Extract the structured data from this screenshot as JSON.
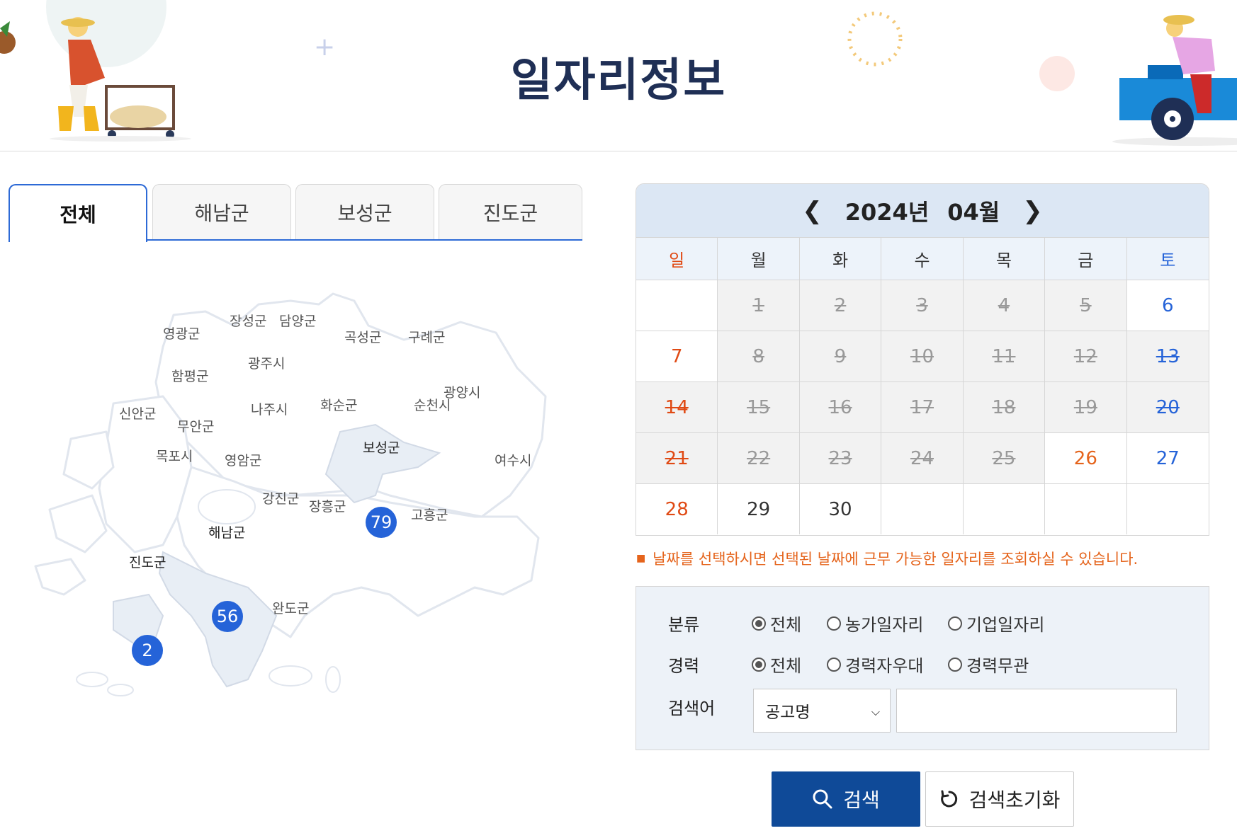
{
  "header": {
    "title": "일자리정보"
  },
  "tabs": [
    {
      "label": "전체",
      "active": true
    },
    {
      "label": "해남군",
      "active": false
    },
    {
      "label": "보성군",
      "active": false
    },
    {
      "label": "진도군",
      "active": false
    }
  ],
  "map": {
    "regions": [
      {
        "name": "영광군"
      },
      {
        "name": "장성군"
      },
      {
        "name": "담양군"
      },
      {
        "name": "곡성군"
      },
      {
        "name": "구례군"
      },
      {
        "name": "광주시"
      },
      {
        "name": "함평군"
      },
      {
        "name": "광양시"
      },
      {
        "name": "신안군"
      },
      {
        "name": "나주시"
      },
      {
        "name": "화순군"
      },
      {
        "name": "순천시"
      },
      {
        "name": "무안군"
      },
      {
        "name": "목포시"
      },
      {
        "name": "영암군"
      },
      {
        "name": "보성군"
      },
      {
        "name": "여수시"
      },
      {
        "name": "강진군"
      },
      {
        "name": "장흥군"
      },
      {
        "name": "고흥군"
      },
      {
        "name": "해남군"
      },
      {
        "name": "진도군"
      },
      {
        "name": "완도군"
      }
    ],
    "counts": {
      "boseong": "79",
      "haenam": "56",
      "jindo": "2"
    }
  },
  "calendar": {
    "year_label": "2024년",
    "month_label": "04월",
    "weekdays": [
      "일",
      "월",
      "화",
      "수",
      "목",
      "금",
      "토"
    ],
    "days": [
      {
        "label": "",
        "state": "blank"
      },
      {
        "label": "1",
        "state": "past"
      },
      {
        "label": "2",
        "state": "past"
      },
      {
        "label": "3",
        "state": "past"
      },
      {
        "label": "4",
        "state": "past"
      },
      {
        "label": "5",
        "state": "past"
      },
      {
        "label": "6",
        "state": "sat"
      },
      {
        "label": "7",
        "state": "sun"
      },
      {
        "label": "8",
        "state": "past"
      },
      {
        "label": "9",
        "state": "past"
      },
      {
        "label": "10",
        "state": "past"
      },
      {
        "label": "11",
        "state": "past"
      },
      {
        "label": "12",
        "state": "past"
      },
      {
        "label": "13",
        "state": "past-sat"
      },
      {
        "label": "14",
        "state": "past-sun"
      },
      {
        "label": "15",
        "state": "past"
      },
      {
        "label": "16",
        "state": "past"
      },
      {
        "label": "17",
        "state": "past"
      },
      {
        "label": "18",
        "state": "past"
      },
      {
        "label": "19",
        "state": "past"
      },
      {
        "label": "20",
        "state": "past-sat"
      },
      {
        "label": "21",
        "state": "past-sun"
      },
      {
        "label": "22",
        "state": "past"
      },
      {
        "label": "23",
        "state": "past"
      },
      {
        "label": "24",
        "state": "past"
      },
      {
        "label": "25",
        "state": "past"
      },
      {
        "label": "26",
        "state": "today"
      },
      {
        "label": "27",
        "state": "sat"
      },
      {
        "label": "28",
        "state": "sun"
      },
      {
        "label": "29",
        "state": "future"
      },
      {
        "label": "30",
        "state": "future"
      },
      {
        "label": "",
        "state": "blank"
      },
      {
        "label": "",
        "state": "blank"
      },
      {
        "label": "",
        "state": "blank"
      },
      {
        "label": "",
        "state": "blank"
      }
    ],
    "note": "날짜를 선택하시면 선택된 날짜에 근무 가능한 일자리를 조회하실 수 있습니다."
  },
  "search": {
    "category": {
      "label": "분류",
      "options": [
        "전체",
        "농가일자리",
        "기업일자리"
      ],
      "selected": "전체"
    },
    "career": {
      "label": "경력",
      "options": [
        "전체",
        "경력자우대",
        "경력무관"
      ],
      "selected": "전체"
    },
    "keyword": {
      "label": "검색어",
      "field_selected": "공고명",
      "value": ""
    },
    "search_button": "검색",
    "reset_button": "검색초기화"
  },
  "colors": {
    "accent": "#2563d8",
    "title": "#1f2f55",
    "search_button": "#0f4a98",
    "sunday": "#e04a14",
    "note": "#e5641c"
  }
}
